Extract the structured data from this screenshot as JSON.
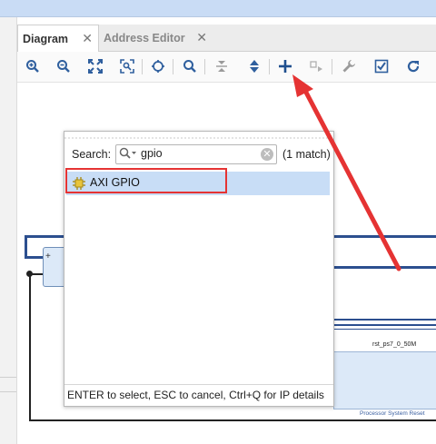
{
  "tabs": [
    {
      "label": "Diagram",
      "close": "✕"
    },
    {
      "label": "Address Editor",
      "close": "✕"
    }
  ],
  "toolbar": {
    "buttons": [
      {
        "icon": "zoom-in-icon"
      },
      {
        "icon": "zoom-out-icon"
      },
      {
        "icon": "zoom-fit-icon"
      },
      {
        "icon": "zoom-area-icon"
      },
      {
        "icon": "select-area-icon"
      },
      {
        "icon": "search-icon"
      },
      {
        "icon": "collapse-icon"
      },
      {
        "icon": "expand-icon"
      },
      {
        "icon": "add-ip-icon"
      },
      {
        "icon": "route-icon"
      },
      {
        "icon": "wrench-icon"
      },
      {
        "icon": "validate-icon"
      },
      {
        "icon": "refresh-icon"
      }
    ]
  },
  "canvas": {
    "block_title": "rst_ps7_0_50M",
    "block_subtitle": "Processor System Reset",
    "plus_glyph": "+"
  },
  "search_popup": {
    "label": "Search:",
    "value": "gpio",
    "clear_glyph": "✕",
    "match_text": "(1 match)",
    "results": [
      {
        "name": "AXI GPIO",
        "icon": "ip-core-icon",
        "selected": true
      }
    ],
    "hint": "ENTER to select, ESC to cancel, Ctrl+Q for IP details"
  },
  "colors": {
    "highlight_border": "#e53333",
    "arrow": "#e53333",
    "selection_bg": "#c8ddf6",
    "wire": "#2c4f8f"
  }
}
